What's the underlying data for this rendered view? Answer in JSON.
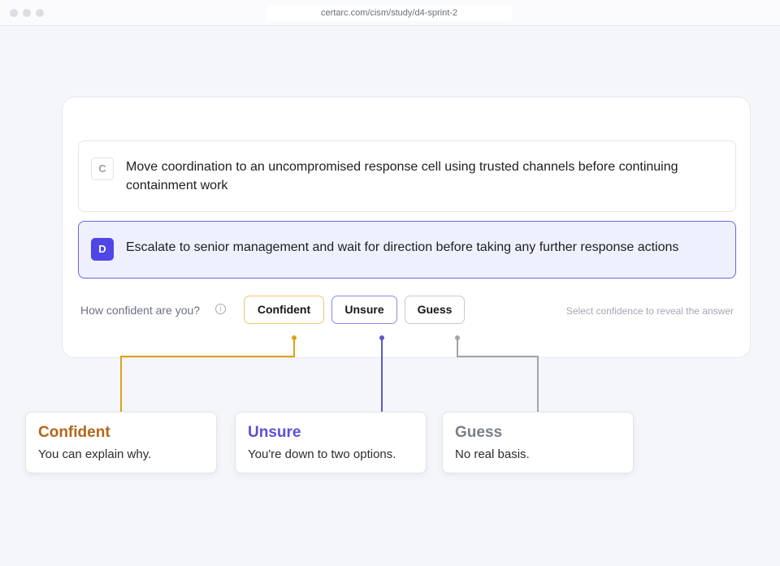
{
  "browser": {
    "url": "certarc.com/cism/study/d4-sprint-2"
  },
  "options": [
    {
      "letter": "C",
      "text": "Move coordination to an uncompromised response cell using trusted channels before continuing containment work",
      "selected": false
    },
    {
      "letter": "D",
      "text": "Escalate to senior management and wait for direction before taking any further response actions",
      "selected": true
    }
  ],
  "confidence": {
    "prompt": "How confident are you?",
    "info_icon": "info-circle-icon",
    "buttons": {
      "confident": "Confident",
      "unsure": "Unsure",
      "guess": "Guess"
    },
    "hint": "Select confidence to reveal the answer"
  },
  "tooltips": {
    "confident": {
      "title": "Confident",
      "desc": "You can explain why."
    },
    "unsure": {
      "title": "Unsure",
      "desc": "You're down to two options."
    },
    "guess": {
      "title": "Guess",
      "desc": "No real basis."
    }
  },
  "colors": {
    "selected_accent": "#4f46e5",
    "confident": "#e0a01a",
    "unsure": "#5a58c8",
    "guess": "#a0a4ab"
  }
}
